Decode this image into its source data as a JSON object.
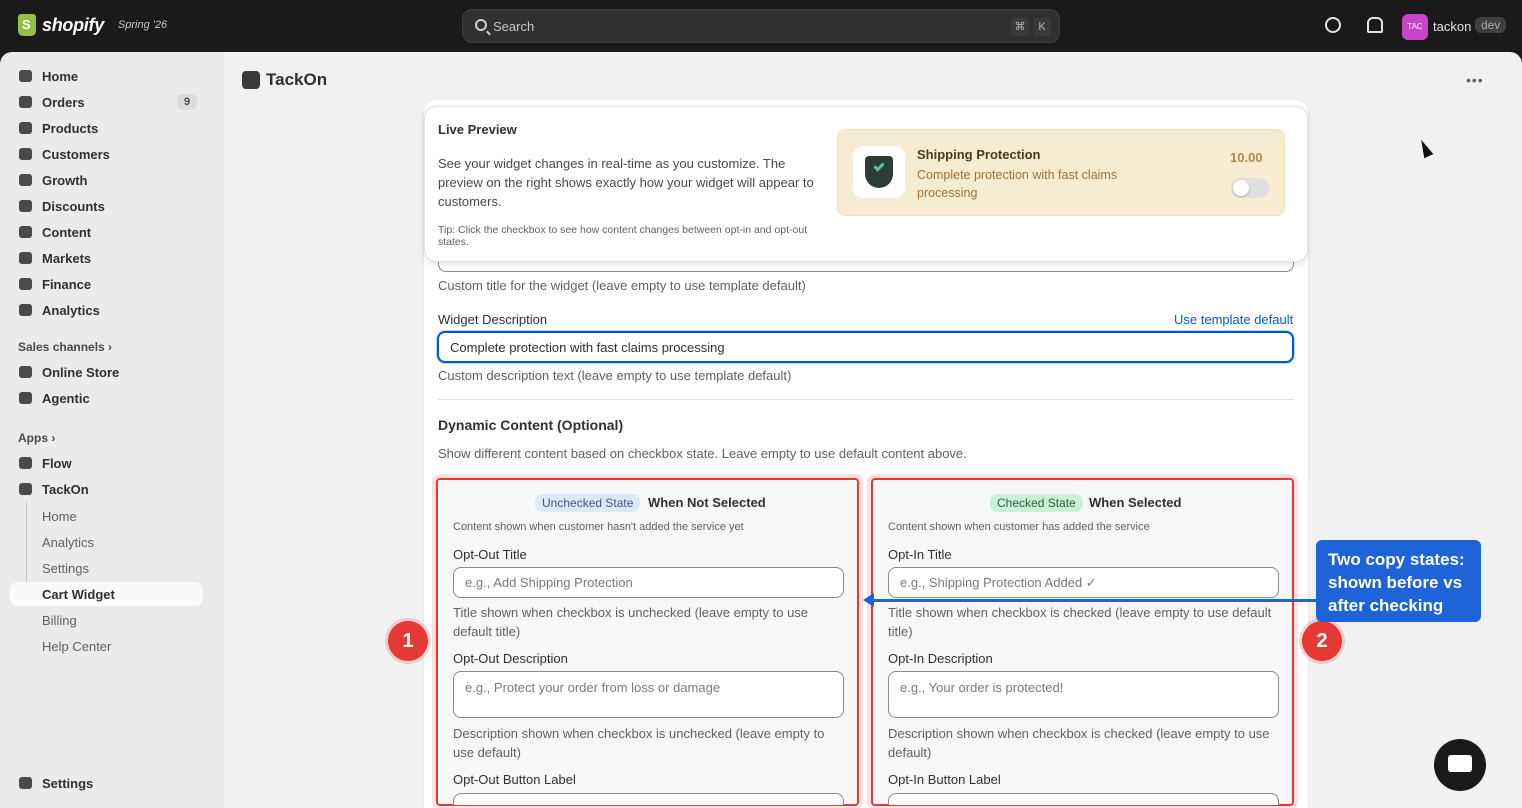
{
  "topbar": {
    "brand": "shopify",
    "edition": "Spring '26",
    "search_placeholder": "Search",
    "shortcut_keys": [
      "⌘",
      "K"
    ],
    "store_badge": "TAC",
    "store_name": "tackon",
    "env_badge": "dev"
  },
  "sidebar": {
    "items": [
      {
        "label": "Home",
        "icon": "home-icon"
      },
      {
        "label": "Orders",
        "icon": "inbox-icon",
        "badge": "9"
      },
      {
        "label": "Products",
        "icon": "tag-icon"
      },
      {
        "label": "Customers",
        "icon": "person-icon"
      },
      {
        "label": "Growth",
        "icon": "growth-icon"
      },
      {
        "label": "Discounts",
        "icon": "discount-icon"
      },
      {
        "label": "Content",
        "icon": "content-icon"
      },
      {
        "label": "Markets",
        "icon": "globe-icon"
      },
      {
        "label": "Finance",
        "icon": "bank-icon"
      },
      {
        "label": "Analytics",
        "icon": "bar-chart-icon"
      }
    ],
    "sales_channels_label": "Sales channels",
    "sales_channels": [
      {
        "label": "Online Store",
        "icon": "store-icon"
      },
      {
        "label": "Agentic",
        "icon": "agent-icon"
      }
    ],
    "apps_label": "Apps",
    "apps": [
      {
        "label": "Flow",
        "icon": "flow-icon"
      },
      {
        "label": "TackOn",
        "icon": "tackon-app-icon"
      }
    ],
    "tackon_sub": [
      "Home",
      "Analytics",
      "Settings",
      "Cart Widget",
      "Billing",
      "Help Center"
    ],
    "settings_label": "Settings"
  },
  "page": {
    "app_title": "TackOn"
  },
  "live_preview": {
    "title": "Live Preview",
    "description": "See your widget changes in real-time as you customize. The preview on the right shows exactly how your widget will appear to customers.",
    "tip": "Tip: Click the checkbox to see how content changes between opt-in and opt-out states.",
    "widget": {
      "title": "Shipping Protection",
      "description": "Complete protection with fast claims processing",
      "price": "10.00",
      "toggle_on": false
    }
  },
  "form": {
    "title_help": "Custom title for the widget (leave empty to use template default)",
    "description_label": "Widget Description",
    "use_template_default": "Use template default",
    "description_value": "Complete protection with fast claims processing",
    "description_help": "Custom description text (leave empty to use template default)",
    "dynamic_title": "Dynamic Content (Optional)",
    "dynamic_help": "Show different content based on checkbox state. Leave empty to use default content above."
  },
  "unchecked": {
    "pill": "Unchecked State",
    "heading": "When Not Selected",
    "help": "Content shown when customer hasn't added the service yet",
    "title_label": "Opt-Out Title",
    "title_placeholder": "e.g., Add Shipping Protection",
    "title_help": "Title shown when checkbox is unchecked (leave empty to use default title)",
    "desc_label": "Opt-Out Description",
    "desc_placeholder": "e.g., Protect your order from loss or damage",
    "desc_help": "Description shown when checkbox is unchecked (leave empty to use default)",
    "button_label": "Opt-Out Button Label"
  },
  "checked": {
    "pill": "Checked State",
    "heading": "When Selected",
    "help": "Content shown when customer has added the service",
    "title_label": "Opt-In Title",
    "title_placeholder": "e.g., Shipping Protection Added ✓",
    "title_help": "Title shown when checkbox is checked (leave empty to use default title)",
    "desc_label": "Opt-In Description",
    "desc_placeholder": "e.g., Your order is protected!",
    "desc_help": "Description shown when checkbox is checked (leave empty to use default)",
    "button_label": "Opt-In Button Label"
  },
  "annotations": {
    "marker_1": "1",
    "marker_2": "2",
    "callout": "Two copy states: shown before vs after checking",
    "accent_color": "#1e64d8",
    "highlight_color": "#e53935"
  }
}
